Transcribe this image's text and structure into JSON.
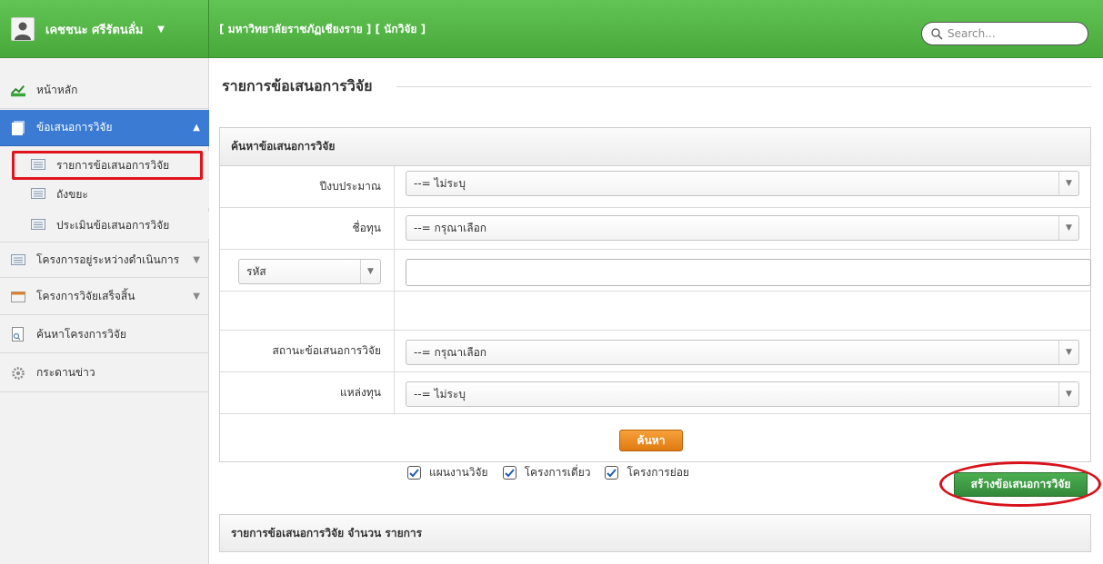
{
  "header": {
    "user_name": "เคชชนะ ศรีรัตนลั่ม",
    "org_title": "[ มหาวิทยาลัยราชภัฏเชียงราย ] [ นักวิจัย ]",
    "search_placeholder": "Search..."
  },
  "sidebar": {
    "home": "หน้าหลัก",
    "proposals": "ข้อเสนอการวิจัย",
    "sub_list": "รายการข้อเสนอการวิจัย",
    "sub_trash": "ถังขยะ",
    "sub_eval": "ประเมินข้อเสนอการวิจัย",
    "ongoing": "โครงการอยู่ระหว่างดำเนินการ",
    "finished": "โครงการวิจัยเสร็จสิ้น",
    "search_projects": "ค้นหาโครงการวิจัย",
    "news": "กระดานข่าว"
  },
  "main": {
    "title": "รายการข้อเสนอการวิจัย",
    "search_panel_title": "ค้นหาข้อเสนอการวิจัย",
    "label_fiscal_year": "ปีงบประมาณ",
    "fiscal_year_value": "--= ไม่ระบุ",
    "label_fund_name": "ชื่อทุน",
    "fund_name_value": "--= กรุณาเลือก",
    "code_select_value": "รหัส",
    "code_input_value": "",
    "check_plan": "แผนงานวิจัย",
    "check_single": "โครงการเดี่ยว",
    "check_sub": "โครงการย่อย",
    "label_status": "สถานะข้อเสนอการวิจัย",
    "status_value": "--= กรุณาเลือก",
    "label_source": "แหล่งทุน",
    "source_value": "--= ไม่ระบุ",
    "search_button": "ค้นหา",
    "create_button": "สร้างข้อเสนอการวิจัย",
    "list_panel_title": "รายการข้อเสนอการวิจัย จำนวน รายการ"
  }
}
